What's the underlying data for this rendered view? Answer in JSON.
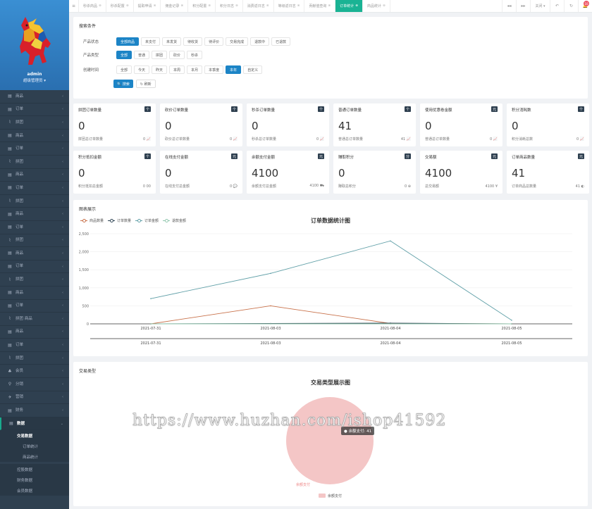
{
  "sidebar": {
    "user": "admin",
    "role": "超级管理员 ▾",
    "items": [
      {
        "icon": "▤",
        "label": "商品"
      },
      {
        "icon": "▤",
        "label": "订单"
      },
      {
        "icon": "⌇",
        "label": "拼团"
      },
      {
        "icon": "▤",
        "label": "商品"
      },
      {
        "icon": "▤",
        "label": "订单"
      },
      {
        "icon": "⌇",
        "label": "拼团"
      },
      {
        "icon": "▤",
        "label": "商品"
      },
      {
        "icon": "▤",
        "label": "订单"
      },
      {
        "icon": "⌇",
        "label": "拼团"
      },
      {
        "icon": "▤",
        "label": "商品"
      },
      {
        "icon": "▤",
        "label": "订单"
      },
      {
        "icon": "⌇",
        "label": "拼团"
      },
      {
        "icon": "▤",
        "label": "商品"
      },
      {
        "icon": "▤",
        "label": "订单"
      },
      {
        "icon": "⌇",
        "label": "拼团"
      },
      {
        "icon": "▤",
        "label": "商品"
      },
      {
        "icon": "▤",
        "label": "订单"
      },
      {
        "icon": "⌇",
        "label": "拼团 商品"
      },
      {
        "icon": "▤",
        "label": "商品"
      },
      {
        "icon": "▤",
        "label": "订单"
      },
      {
        "icon": "⌇",
        "label": "拼团"
      },
      {
        "icon": "♣",
        "label": "会员"
      },
      {
        "icon": "⚲",
        "label": "分销"
      },
      {
        "icon": "✈",
        "label": "营销"
      },
      {
        "icon": "▤",
        "label": "财务"
      }
    ],
    "active": {
      "icon": "▤",
      "label": "数据"
    },
    "sub": {
      "group": "交易数据",
      "children": [
        "订单统计",
        "商品统计"
      ]
    },
    "tail": [
      "控股数据",
      "财务数据",
      "会员数据"
    ]
  },
  "topbar": {
    "menu_icon": "≡",
    "tabs": [
      "秒杀商品",
      "秒杀配置",
      "提取申请",
      "佣金记录",
      "积分配置",
      "积分日志",
      "消费返日志",
      "等级返日志",
      "贡献值查询",
      "订单统计",
      "商品统计"
    ],
    "active_tab": "订单统计",
    "right": [
      "◂◂",
      "▸▸",
      "关闭 ▾",
      "↶",
      "↻"
    ],
    "badge": "10"
  },
  "search": {
    "title": "搜索条件",
    "rows": [
      {
        "label": "产品状态",
        "options": [
          "全部商品",
          "未支付",
          "未发货",
          "待收货",
          "待评价",
          "交易完成",
          "退款中",
          "已退款"
        ],
        "selected": 0
      },
      {
        "label": "产品类型",
        "options": [
          "全部",
          "普通",
          "拼团",
          "砍价",
          "秒杀"
        ],
        "selected": 0
      },
      {
        "label": "创建时间",
        "options": [
          "全部",
          "今天",
          "昨天",
          "本周",
          "本月",
          "本季度",
          "本年",
          "自定义"
        ],
        "selected": 6
      }
    ],
    "search_btn": "🔍 搜索",
    "refresh_btn": "↻ 刷新"
  },
  "cards": [
    {
      "title": "拼团订单数量",
      "badge": "个",
      "value": "0",
      "sub": "拼团总订单数量",
      "right": "0 📈"
    },
    {
      "title": "砍价订单数量",
      "badge": "个",
      "value": "0",
      "sub": "砍价总订单数量",
      "right": "0 📈"
    },
    {
      "title": "秒杀订单数量",
      "badge": "个",
      "value": "0",
      "sub": "秒杀总订单数量",
      "right": "0 📈"
    },
    {
      "title": "普通订单数量",
      "badge": "个",
      "value": "41",
      "sub": "普通总订单数量",
      "right": "41 📈"
    },
    {
      "title": "使用优惠卷金额",
      "badge": "元",
      "value": "0",
      "sub": "普通总订单数量",
      "right": "0 📈"
    },
    {
      "title": "积分消耗数",
      "badge": "个",
      "value": "0",
      "sub": "积分消耗总数",
      "right": "0 📈"
    },
    {
      "title": "积分抵扣金额",
      "badge": "个",
      "value": "0",
      "sub": "积分抵扣总金额",
      "right": "0 00"
    },
    {
      "title": "在线支付金额",
      "badge": "元",
      "value": "0",
      "sub": "在线支付总金额",
      "right": "0 💬"
    },
    {
      "title": "余额支付金额",
      "badge": "元",
      "value": "4100",
      "sub": "余额支付总金额",
      "right": "4100 ⛟"
    },
    {
      "title": "赚取积分",
      "badge": "分",
      "value": "0",
      "sub": "赚取总积分",
      "right": "0 ⊕"
    },
    {
      "title": "交易额",
      "badge": "元",
      "value": "4100",
      "sub": "总交易额",
      "right": "4100 ¥"
    },
    {
      "title": "订单商品数量",
      "badge": "元",
      "value": "41",
      "sub": "订单商品总数量",
      "right": "41 ◐"
    }
  ],
  "chart_panel": {
    "title": "图表展示"
  },
  "chart_data": {
    "type": "line",
    "title": "订单数据统计图",
    "categories": [
      "2021-07-31",
      "2021-08-03",
      "2021-08-04",
      "2021-08-05"
    ],
    "series": [
      {
        "name": "商品数量",
        "color": "#c8714a",
        "values": [
          0,
          500,
          10,
          0
        ]
      },
      {
        "name": "订单数量",
        "color": "#2f4554",
        "values": [
          0,
          10,
          20,
          0
        ]
      },
      {
        "name": "订单金额",
        "color": "#61a0a8",
        "values": [
          700,
          1400,
          2300,
          100
        ]
      },
      {
        "name": "退款金额",
        "color": "#91c7ae",
        "values": [
          0,
          0,
          0,
          0
        ]
      }
    ],
    "ylim": [
      0,
      2500
    ],
    "yticks": [
      "0",
      "500",
      "1,000",
      "1,500",
      "2,000",
      "2,500"
    ],
    "legend": "top-left",
    "grid": true
  },
  "trade_panel": {
    "title": "交易类型",
    "chart_title": "交易类型展示图",
    "tooltip": "● 余额支付: 41",
    "pie_label": "余额支付",
    "legend": "余额支付",
    "pie": {
      "type": "pie",
      "slices": [
        {
          "name": "余额支付",
          "value": 41,
          "color": "#f4c6c6"
        }
      ]
    }
  },
  "watermark": "https://www.huzhan.com/ishop41592"
}
